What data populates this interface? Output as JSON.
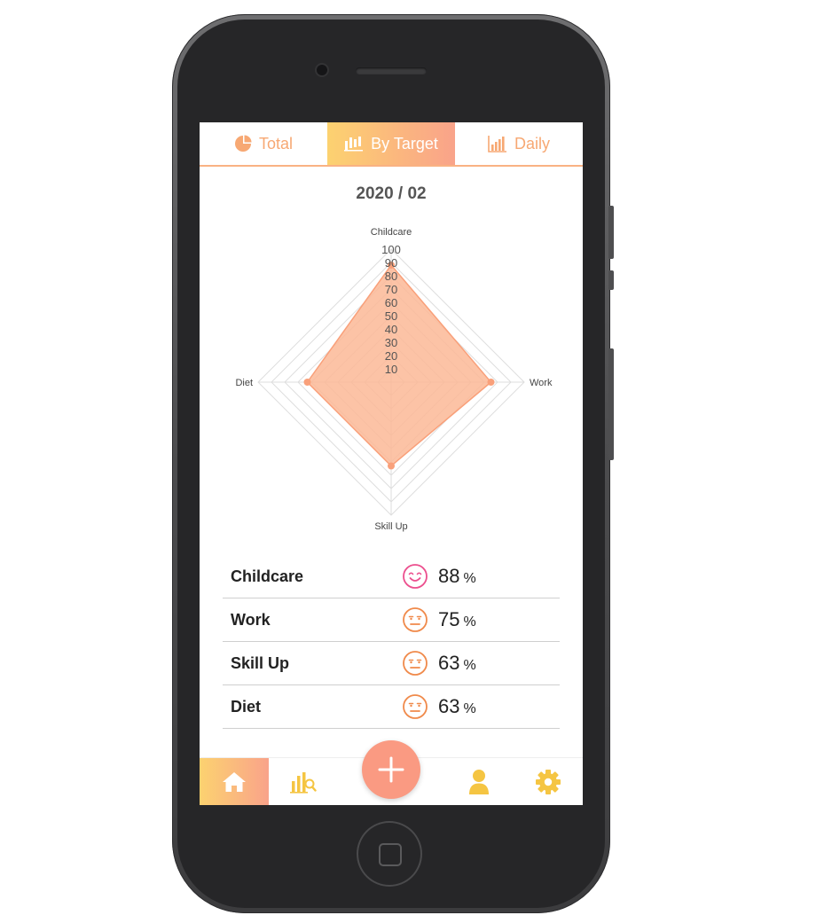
{
  "app": {
    "tabs": [
      {
        "label": "Total",
        "icon": "pie-chart-icon",
        "active": false
      },
      {
        "label": "By Target",
        "icon": "bar-chart-icon",
        "active": true
      },
      {
        "label": "Daily",
        "icon": "daily-bars-icon",
        "active": false
      }
    ],
    "period": "2020 / 02"
  },
  "chart_data": {
    "type": "radar",
    "axes": [
      "Childcare",
      "Work",
      "Skill Up",
      "Diet"
    ],
    "values": [
      88,
      75,
      63,
      63
    ],
    "range": [
      0,
      100
    ],
    "ticks": [
      "10",
      "20",
      "30",
      "40",
      "50",
      "60",
      "70",
      "80",
      "90",
      "100"
    ],
    "fill_color": "#fbb896",
    "stroke_color": "#f9a07a"
  },
  "targets": [
    {
      "name": "Childcare",
      "value": "88",
      "unit": "%",
      "mood": "smile-face-icon"
    },
    {
      "name": "Work",
      "value": "75",
      "unit": "%",
      "mood": "neutral-face-icon"
    },
    {
      "name": "Skill Up",
      "value": "63",
      "unit": "%",
      "mood": "neutral-face-icon"
    },
    {
      "name": "Diet",
      "value": "63",
      "unit": "%",
      "mood": "neutral-face-icon"
    }
  ],
  "bottom_nav": [
    {
      "icon": "home-icon",
      "active": true
    },
    {
      "icon": "analytics-icon",
      "active": false
    },
    {
      "icon": "add-icon",
      "active": false
    },
    {
      "icon": "user-icon",
      "active": false
    },
    {
      "icon": "settings-icon",
      "active": false
    }
  ],
  "colors": {
    "accent_yellow": "#fcd270",
    "accent_salmon": "#f9a38a",
    "tab_text": "#f7a873",
    "smile_face": "#ec4f8e",
    "neutral_face": "#f08a4b"
  }
}
